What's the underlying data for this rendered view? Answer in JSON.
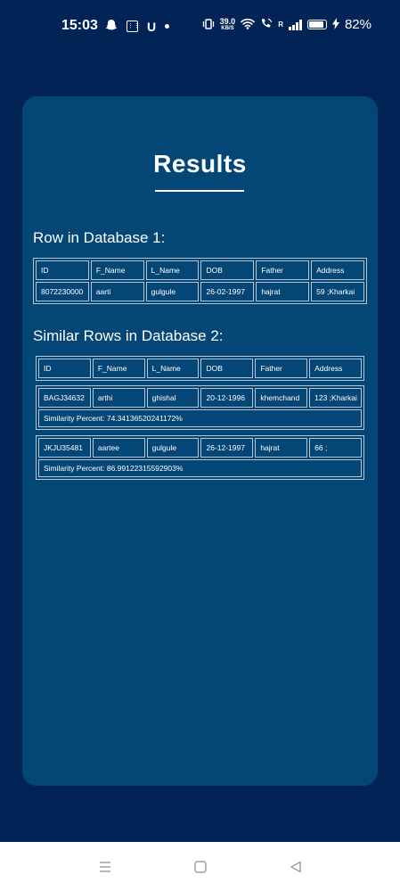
{
  "status_bar": {
    "time": "15:03",
    "carrier_letter": "U",
    "speed_value": "39.0",
    "speed_unit": "KB/S",
    "signal_label": "R",
    "battery_percent": "82%"
  },
  "card": {
    "title": "Results",
    "db1_heading": "Row in Database 1:",
    "db2_heading": "Similar Rows in Database 2:"
  },
  "db1_table": {
    "headers": [
      "ID",
      "F_Name",
      "L_Name",
      "DOB",
      "Father",
      "Address"
    ],
    "row": [
      "8072230000",
      "aarti",
      "gulgule",
      "26-02-1997",
      "hajrat",
      "59 ;Kharkai"
    ]
  },
  "db2_table": {
    "headers": [
      "ID",
      "F_Name",
      "L_Name",
      "DOB",
      "Father",
      "Address"
    ],
    "rows": [
      {
        "cells": [
          "BAGJ34632",
          "arthi",
          "ghishal",
          "20-12-1996",
          "khemchand",
          "123 ;Kharkai"
        ],
        "similarity": "Similarity Percent: 74.34136520241172%"
      },
      {
        "cells": [
          "JKJU35481",
          "aartee",
          "gulgule",
          "26-12-1997",
          "hajrat",
          "66 ;"
        ],
        "similarity": "Similarity Percent: 86.99122315592903%"
      }
    ]
  },
  "colors": {
    "page_background": "#022356",
    "card_background": "#044676",
    "table_border": "#b9c6d2",
    "nav_bar": "#ffffff"
  },
  "nav": {
    "recents_icon": "menu-lines-icon",
    "home_icon": "square-home-icon",
    "back_icon": "triangle-back-icon"
  }
}
